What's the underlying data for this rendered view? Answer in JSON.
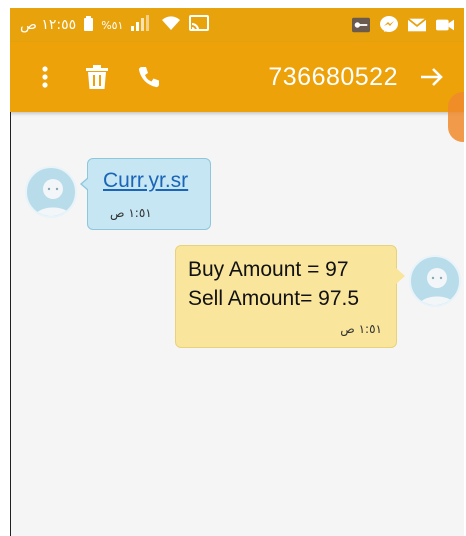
{
  "status_bar": {
    "time": "١٢:٥٥ ص",
    "battery": "%٥١",
    "icons": [
      "battery-icon",
      "signal-icon",
      "wifi-icon",
      "cast-icon",
      "vpn-key-icon",
      "messenger-icon",
      "mail-icon",
      "camera-icon"
    ]
  },
  "header": {
    "phone_number": "736680522",
    "actions": [
      "more-options-icon",
      "delete-icon",
      "call-icon",
      "forward-arrow-icon"
    ],
    "color": "#eda20a"
  },
  "messages": [
    {
      "direction": "incoming",
      "text": "Curr.yr.sr",
      "is_link": true,
      "time": "١:٥١ ص",
      "bubble_color": "#c6e6f3"
    },
    {
      "direction": "outgoing",
      "lines": [
        "Buy Amount = 97",
        "Sell Amount= 97.5"
      ],
      "time": "١:٥١ ص",
      "bubble_color": "#f9e59b"
    }
  ]
}
